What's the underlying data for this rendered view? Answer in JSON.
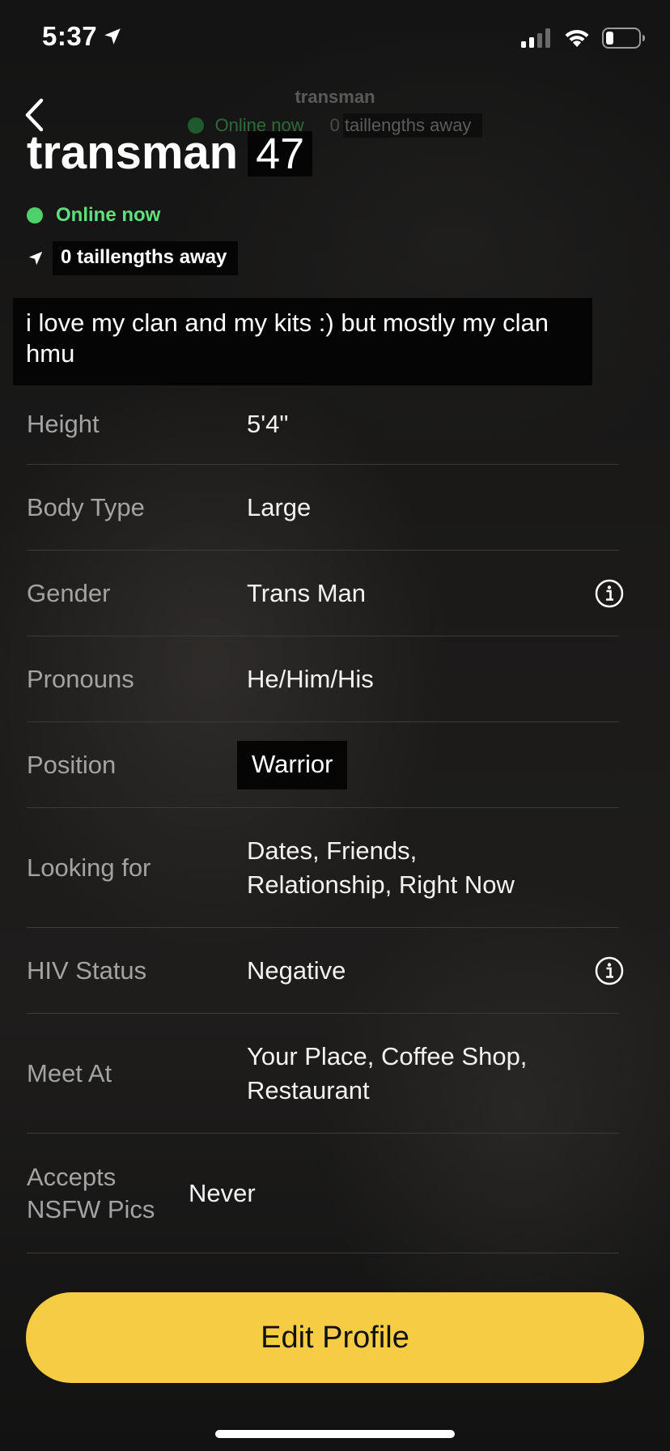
{
  "status_bar": {
    "time": "5:37",
    "location_icon": "location-arrow-icon",
    "signal_icon": "cellular-signal-icon",
    "wifi_icon": "wifi-icon",
    "battery_icon": "battery-low-icon"
  },
  "header": {
    "back_icon": "chevron-left-icon",
    "mini_name": "transman",
    "mini_online": "Online now",
    "mini_distance_number": "0",
    "mini_distance_text": "taillengths away"
  },
  "profile": {
    "name": "transman",
    "age": "47",
    "online_status": "Online now",
    "distance": "0 taillengths away",
    "bio": "i love my clan and my kits :) but mostly my clan hmu"
  },
  "details": [
    {
      "label": "Height",
      "value": "5'4\"",
      "info": false
    },
    {
      "label": "Body Type",
      "value": "Large",
      "info": false
    },
    {
      "label": "Gender",
      "value": "Trans Man",
      "info": true
    },
    {
      "label": "Pronouns",
      "value": "He/Him/His",
      "info": false
    },
    {
      "label": "Position",
      "value": "Warrior",
      "info": false,
      "boxed": true
    },
    {
      "label": "Looking for",
      "value": "Dates, Friends, Relationship, Right Now",
      "info": false
    },
    {
      "label": "HIV Status",
      "value": "Negative",
      "info": true
    },
    {
      "label": "Meet At",
      "value": "Your Place, Coffee Shop, Restaurant",
      "info": false
    },
    {
      "label": "Accepts NSFW Pics",
      "value": "Never",
      "info": false
    }
  ],
  "actions": {
    "edit_profile_label": "Edit Profile"
  },
  "colors": {
    "accent": "#f7cc45",
    "online": "#5fe07a",
    "background": "#161616"
  }
}
